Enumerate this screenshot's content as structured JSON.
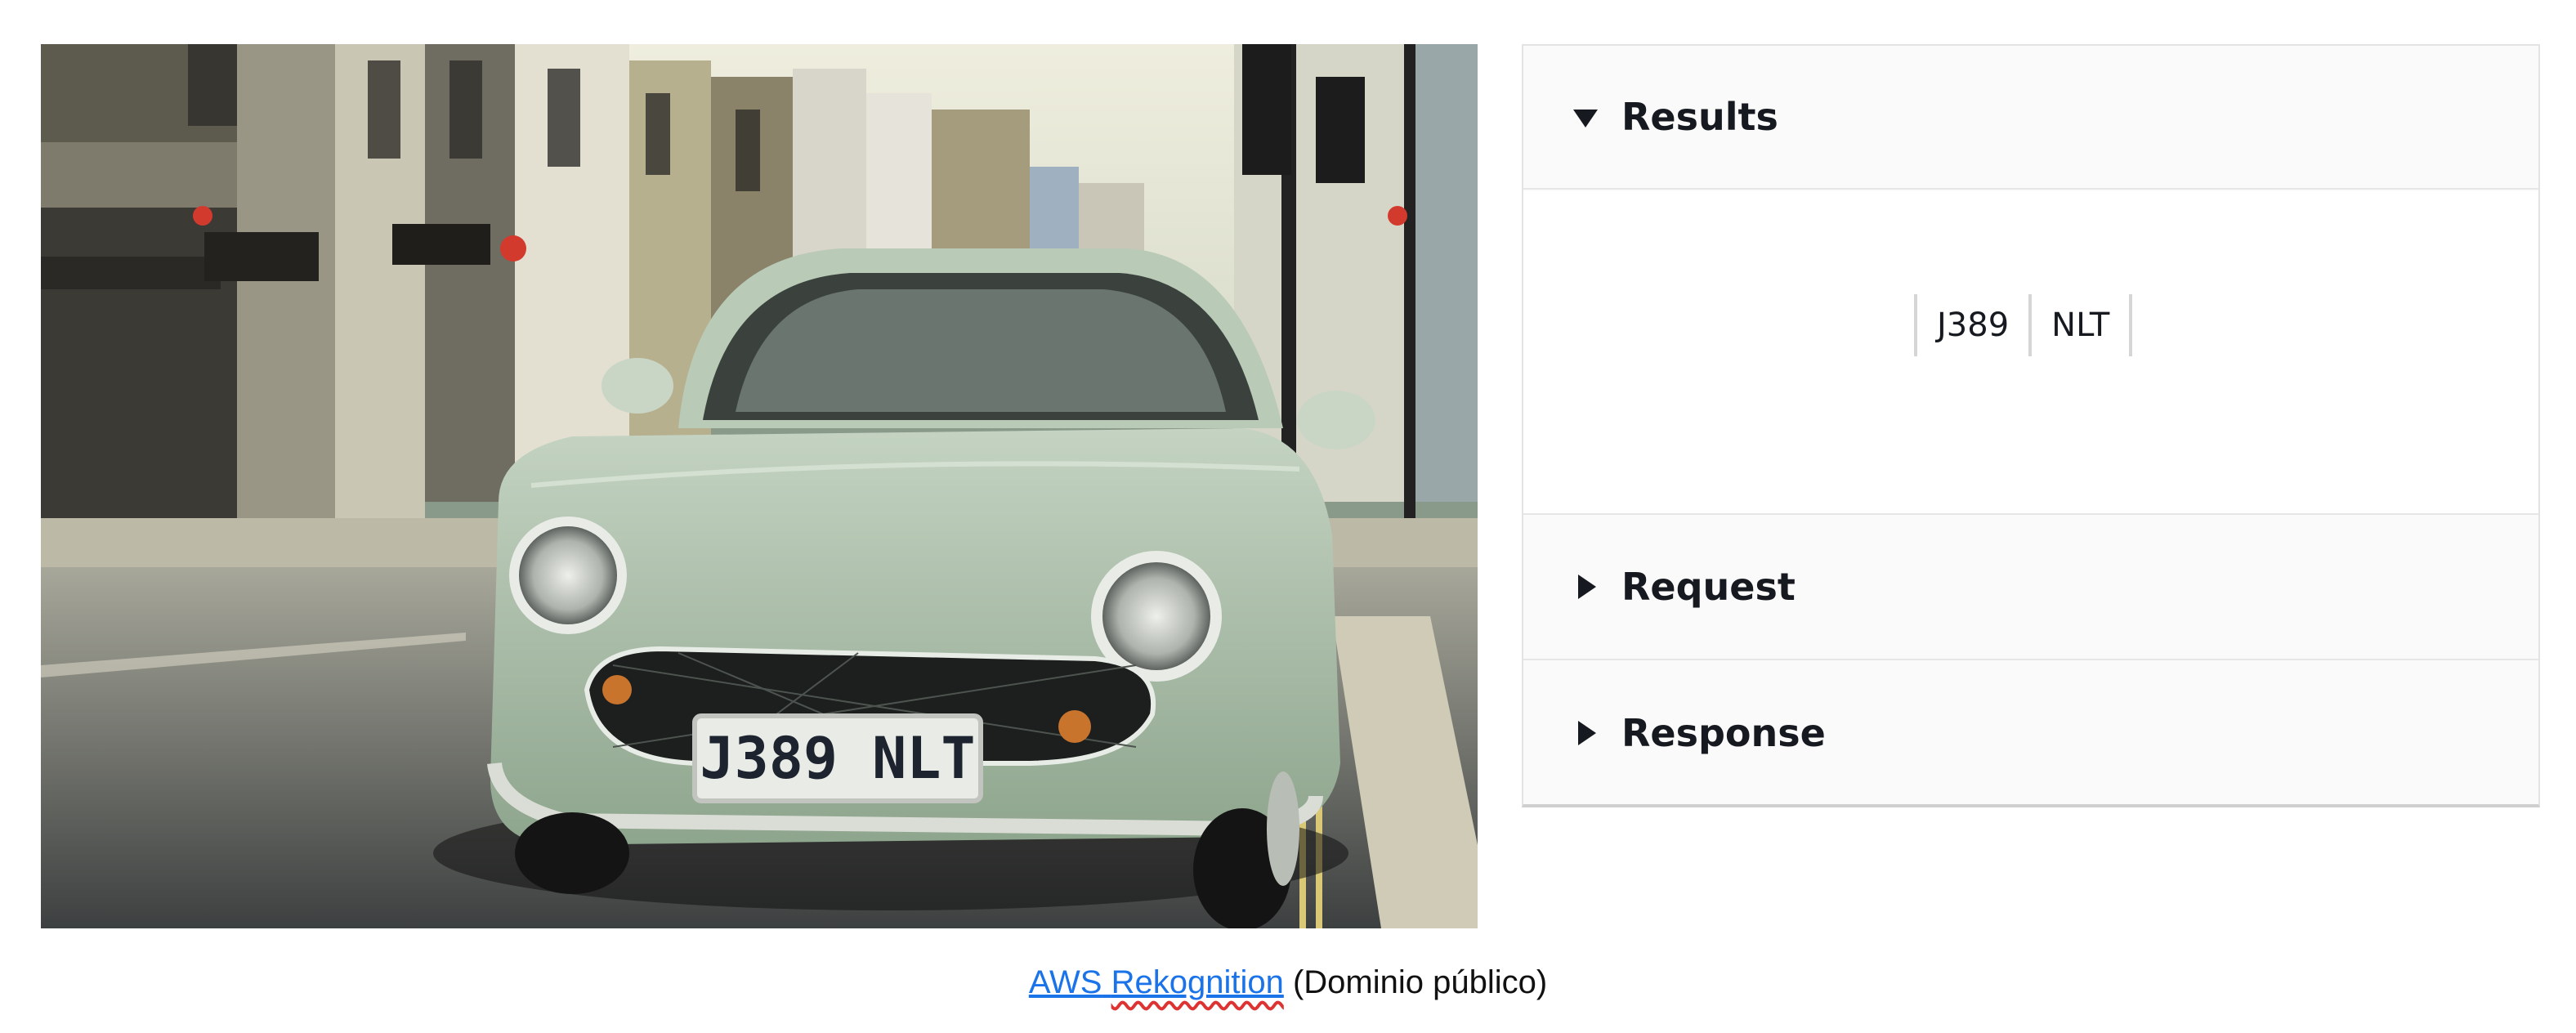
{
  "photo": {
    "alt_plate_text": "J389 NLT",
    "car_color": "#a9bfa8",
    "icons": {
      "plate": "license-plate"
    }
  },
  "panel": {
    "results": {
      "title": "Results",
      "expanded": true,
      "tokens": [
        "J389",
        "NLT"
      ]
    },
    "request": {
      "title": "Request",
      "expanded": false
    },
    "response": {
      "title": "Response",
      "expanded": false
    }
  },
  "caption": {
    "link_text_1": "AWS",
    "link_text_2": "Rekognition",
    "suffix": " (Dominio público)"
  },
  "colors": {
    "link": "#1a73e8",
    "header_bg": "#fafafa",
    "border": "#e3e3e3"
  }
}
